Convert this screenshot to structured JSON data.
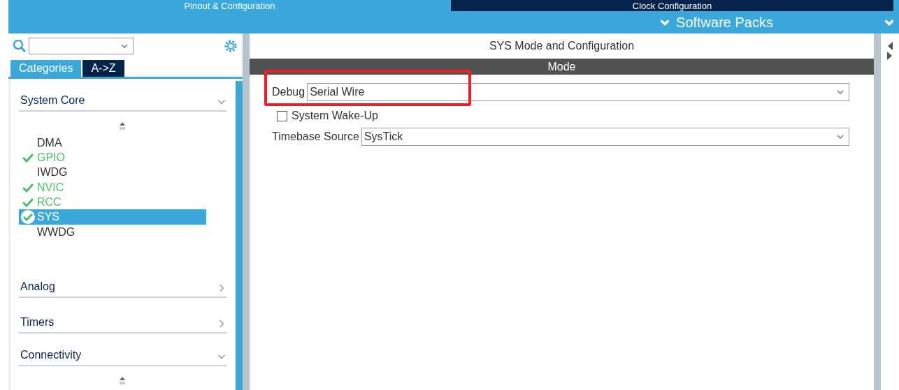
{
  "top_tabs": [
    {
      "label": "Pinout & Configuration",
      "selected": true
    },
    {
      "label": "Clock Configuration",
      "selected": false
    }
  ],
  "menu": [
    {
      "label": "Software Packs"
    }
  ],
  "sidebar": {
    "tabs": [
      {
        "label": "Categories",
        "selected": true
      },
      {
        "label": "A->Z",
        "selected": false
      }
    ],
    "categories": [
      {
        "label": "System Core",
        "expanded": true,
        "children": [
          {
            "label": "DMA",
            "enabled": false,
            "selected": false
          },
          {
            "label": "GPIO",
            "enabled": true,
            "selected": false
          },
          {
            "label": "IWDG",
            "enabled": false,
            "selected": false
          },
          {
            "label": "NVIC",
            "enabled": true,
            "selected": false
          },
          {
            "label": "RCC",
            "enabled": true,
            "selected": false
          },
          {
            "label": "SYS",
            "enabled": true,
            "selected": true
          },
          {
            "label": "WWDG",
            "enabled": false,
            "selected": false
          }
        ]
      },
      {
        "label": "Analog",
        "expanded": false
      },
      {
        "label": "Timers",
        "expanded": false
      },
      {
        "label": "Connectivity",
        "expanded": true
      }
    ]
  },
  "panel": {
    "title": "SYS Mode and Configuration",
    "section": "Mode",
    "fields": [
      {
        "kind": "select",
        "label": "Debug",
        "value": "Serial Wire",
        "highlighted": true
      },
      {
        "kind": "checkbox",
        "label": "System Wake-Up",
        "checked": false
      },
      {
        "kind": "select",
        "label": "Timebase Source",
        "value": "SysTick"
      }
    ]
  }
}
